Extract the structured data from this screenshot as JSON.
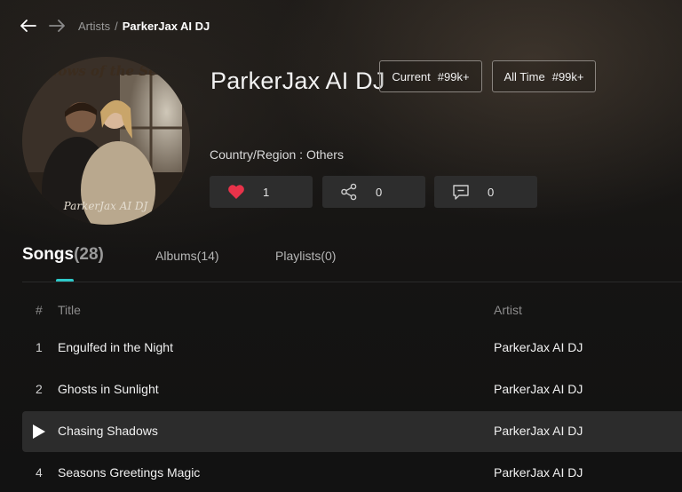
{
  "breadcrumb": {
    "parent": "Artists",
    "separator": "/",
    "current": "ParkerJax AI DJ"
  },
  "artist": {
    "name": "ParkerJax AI DJ",
    "avatar_text_top": "adows of the Seas",
    "avatar_text_bottom": "ParkerJax AI DJ",
    "region": "Country/Region : Others"
  },
  "ranks": {
    "current_label": "Current",
    "current_value": "#99k+",
    "alltime_label": "All Time",
    "alltime_value": "#99k+"
  },
  "stats": {
    "likes": "1",
    "shares": "0",
    "comments": "0"
  },
  "tabs": {
    "songs_label": "Songs",
    "songs_count": "(28)",
    "albums": "Albums(14)",
    "playlists": "Playlists(0)"
  },
  "table": {
    "headers": {
      "index": "#",
      "title": "Title",
      "artist": "Artist"
    },
    "rows": [
      {
        "index": "1",
        "title": "Engulfed in the Night",
        "artist": "ParkerJax AI DJ"
      },
      {
        "index": "2",
        "title": "Ghosts in Sunlight",
        "artist": "ParkerJax AI DJ"
      },
      {
        "index": "",
        "title": "Chasing Shadows",
        "artist": "ParkerJax AI DJ"
      },
      {
        "index": "4",
        "title": "Seasons Greetings Magic",
        "artist": "ParkerJax AI DJ"
      }
    ]
  },
  "colors": {
    "accent": "#2ec9c9",
    "heart": "#e8334a",
    "active_row": "#2c2c2c"
  },
  "icons": [
    "back-arrow-icon",
    "forward-arrow-icon",
    "heart-icon",
    "share-icon",
    "comment-icon",
    "play-icon"
  ]
}
